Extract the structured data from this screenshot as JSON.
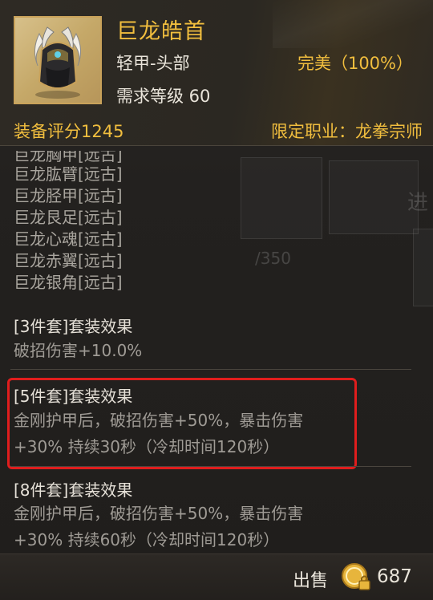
{
  "item": {
    "name": "巨龙皓首",
    "type": "轻甲-头部",
    "quality": "完美（100%）",
    "required_level": "需求等级 60",
    "score": "装备评分1245",
    "class_restriction": "限定职业：龙拳宗师",
    "icon": "dragon-helmet-icon"
  },
  "set_pieces": [
    "巨龙胸甲[远古]",
    "巨龙肱臂[远古]",
    "巨龙胫甲[远古]",
    "巨龙艮足[远古]",
    "巨龙心魂[远古]",
    "巨龙赤翼[远古]",
    "巨龙银角[远古]"
  ],
  "set_bonuses": [
    {
      "title": "[3件套]套装效果",
      "lines": [
        "破招伤害+10.0%"
      ]
    },
    {
      "title": "[5件套]套装效果",
      "lines": [
        "金刚护甲后，破招伤害+50%，暴击伤害",
        "+30% 持续30秒（冷却时间120秒）"
      ]
    },
    {
      "title": "[8件套]套装效果",
      "lines": [
        "金刚护甲后，破招伤害+50%，暴击伤害",
        "+30% 持续60秒（冷却时间120秒）"
      ]
    }
  ],
  "background": {
    "progress_text": "/350",
    "side_text": "进"
  },
  "footer": {
    "sell_label": "出售",
    "price": "687",
    "currency_icon": "gold-coin-lock-icon"
  },
  "colors": {
    "gold": "#f1be3e",
    "highlight": "#e01d1d"
  }
}
